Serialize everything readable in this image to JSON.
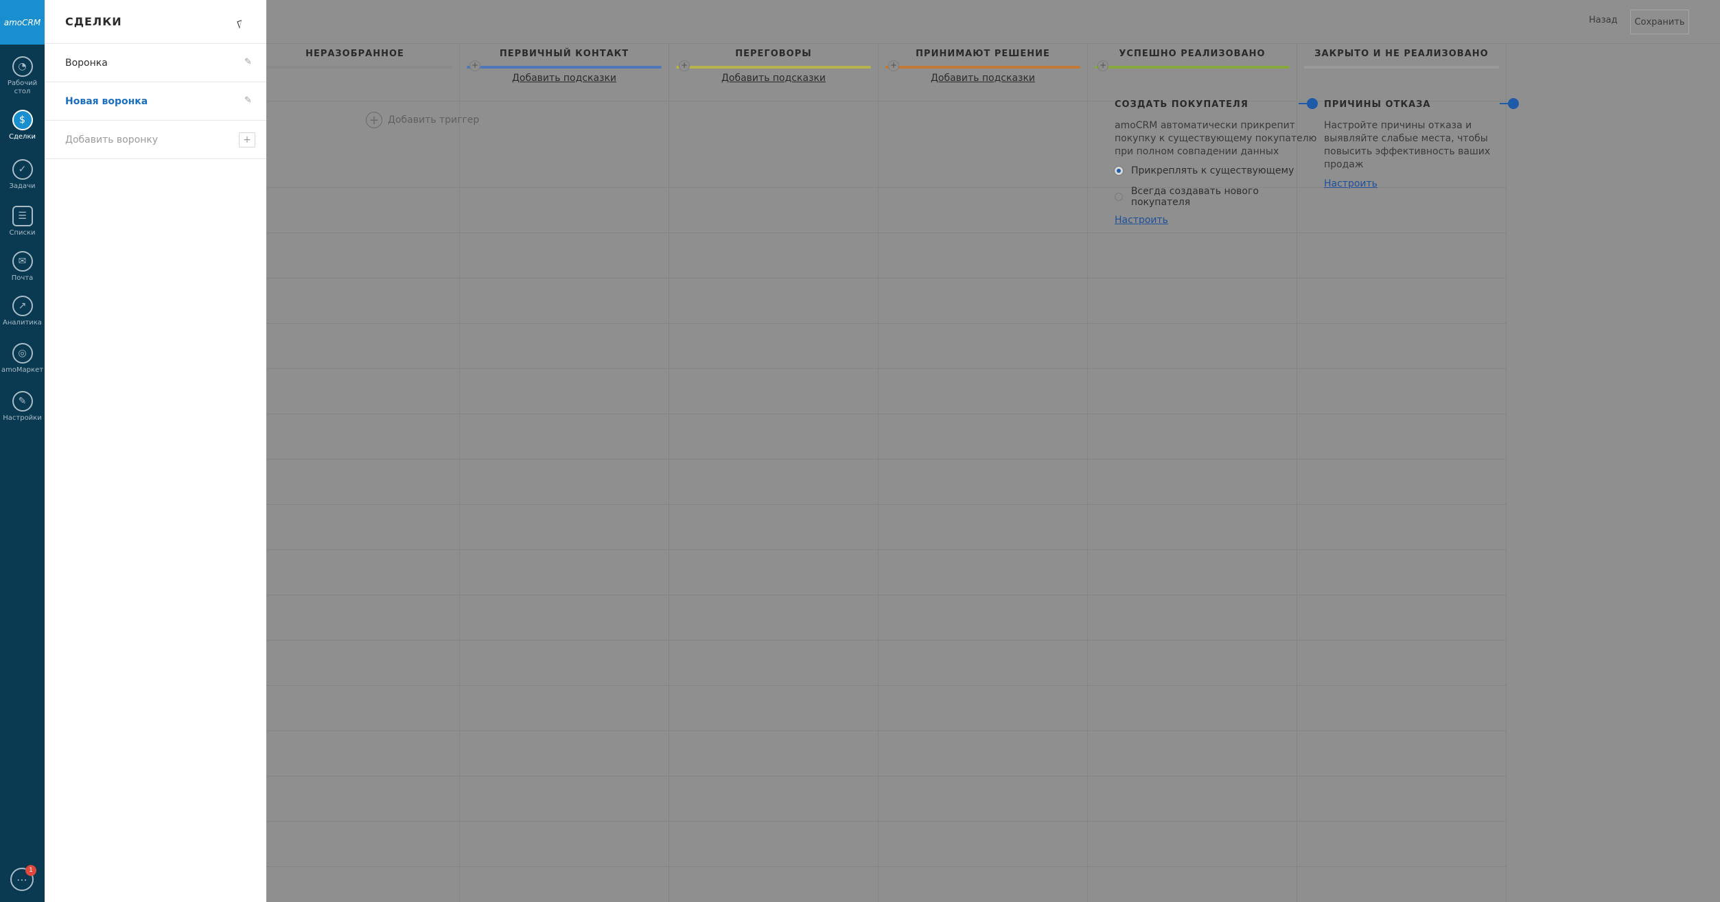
{
  "nav": {
    "logo": "amoCRM",
    "items": [
      {
        "label": "Рабочий стол",
        "icon": "gauge-icon"
      },
      {
        "label": "Сделки",
        "icon": "deals-icon",
        "active": true
      },
      {
        "label": "Задачи",
        "icon": "check-icon"
      },
      {
        "label": "Списки",
        "icon": "list-icon"
      },
      {
        "label": "Почта",
        "icon": "mail-icon"
      },
      {
        "label": "Аналитика",
        "icon": "analytics-icon"
      },
      {
        "label": "amoМаркет",
        "icon": "market-icon"
      },
      {
        "label": "Настройки",
        "icon": "wrench-icon"
      }
    ],
    "chat_badge": "1"
  },
  "topbar": {
    "back_label": "Назад",
    "save_label": "Сохранить"
  },
  "columns": [
    {
      "title": "НЕРАЗОБРАННОЕ",
      "color": "#8a8a8a",
      "hint": ""
    },
    {
      "title": "ПЕРВИЧНЫЙ КОНТАКТ",
      "color": "#4f76b8",
      "hint": "Добавить подсказки"
    },
    {
      "title": "ПЕРЕГОВОРЫ",
      "color": "#b5b34a",
      "hint": "Добавить подсказки"
    },
    {
      "title": "ПРИНИМАЮТ РЕШЕНИЕ",
      "color": "#c47a36",
      "hint": "Добавить подсказки"
    },
    {
      "title": "УСПЕШНО РЕАЛИЗОВАНО",
      "color": "#86a83c",
      "hint": ""
    },
    {
      "title": "ЗАКРЫТО И НЕ РЕАЛИЗОВАНО",
      "color": "#9a9a9a",
      "hint": ""
    }
  ],
  "add_trigger": "Добавить триггер",
  "create_buyer": {
    "title": "СОЗДАТЬ ПОКУПАТЕЛЯ",
    "text": "amoCRM автоматически прикрепит покупку к существующему покупателю при полном совпадении данных",
    "option1": "Прикреплять к существующему",
    "option2": "Всегда создавать нового покупателя",
    "link": "Настроить"
  },
  "loss_reasons": {
    "title": "ПРИЧИНЫ ОТКАЗА",
    "text": "Настройте причины отказа и выявляйте слабые места, чтобы повысить эффективность ваших продаж",
    "link": "Настроить"
  },
  "panel": {
    "title": "СДЕЛКИ",
    "pipelines": [
      {
        "label": "Воронка"
      },
      {
        "label": "Новая воронка"
      }
    ],
    "add_pipeline": "Добавить воронку"
  }
}
